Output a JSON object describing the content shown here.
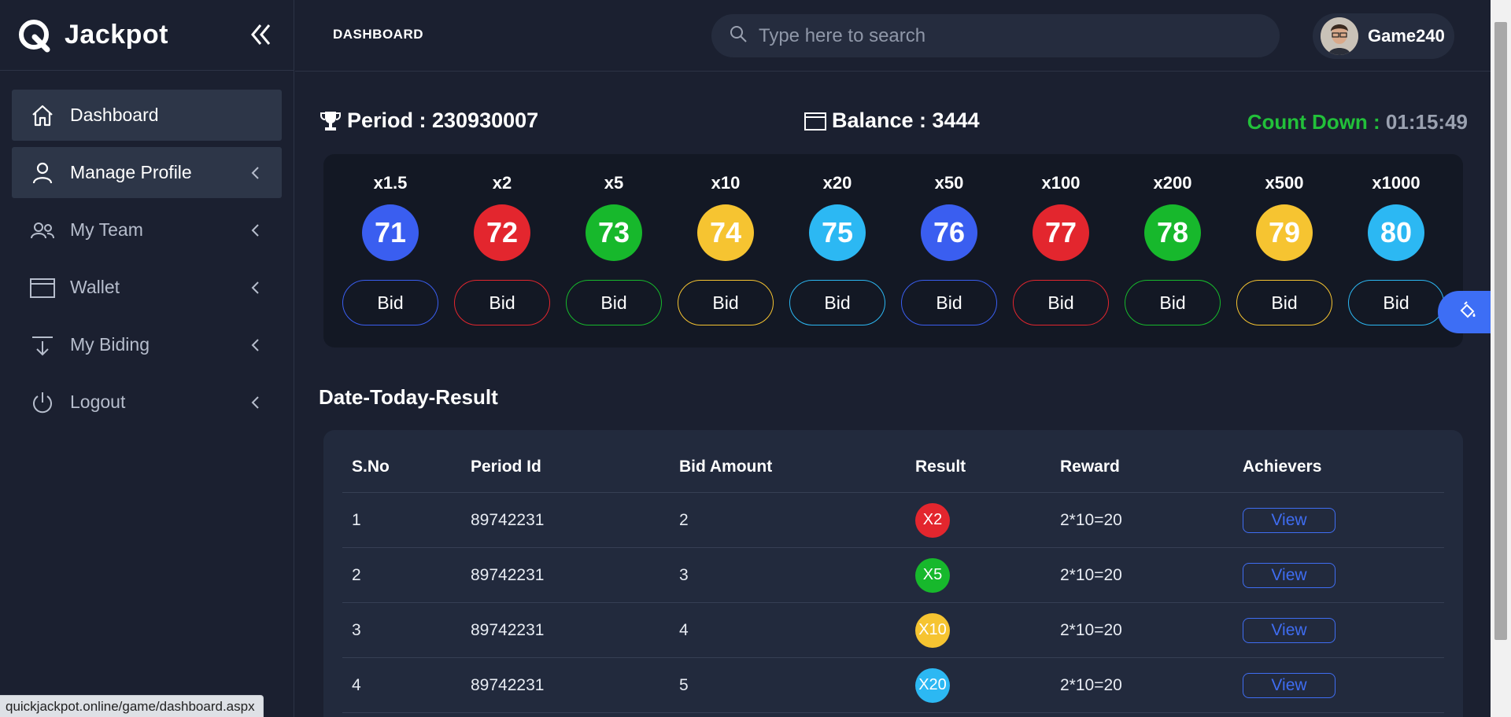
{
  "brand": {
    "name": "Jackpot"
  },
  "sidebar": {
    "items": [
      {
        "label": "Dashboard",
        "icon": "home-icon"
      },
      {
        "label": "Manage Profile",
        "icon": "user-icon"
      },
      {
        "label": "My Team",
        "icon": "team-icon"
      },
      {
        "label": "Wallet",
        "icon": "wallet-icon"
      },
      {
        "label": "My Biding",
        "icon": "download-icon"
      },
      {
        "label": "Logout",
        "icon": "power-icon"
      }
    ]
  },
  "header": {
    "title": "DASHBOARD",
    "search_placeholder": "Type here to search",
    "username": "Game240"
  },
  "stats": {
    "period_label": "Period : 230930007",
    "balance_label": "Balance : 3444",
    "countdown_label": "Count Down :",
    "countdown_time": "01:15:49"
  },
  "bids": [
    {
      "mult": "x1.5",
      "num": "71",
      "color": "#3a5ef0",
      "bid": "Bid"
    },
    {
      "mult": "x2",
      "num": "72",
      "color": "#e3262e",
      "bid": "Bid"
    },
    {
      "mult": "x5",
      "num": "73",
      "color": "#17b82c",
      "bid": "Bid"
    },
    {
      "mult": "x10",
      "num": "74",
      "color": "#f6c431",
      "bid": "Bid"
    },
    {
      "mult": "x20",
      "num": "75",
      "color": "#2cb8f3",
      "bid": "Bid"
    },
    {
      "mult": "x50",
      "num": "76",
      "color": "#3a5ef0",
      "bid": "Bid"
    },
    {
      "mult": "x100",
      "num": "77",
      "color": "#e3262e",
      "bid": "Bid"
    },
    {
      "mult": "x200",
      "num": "78",
      "color": "#17b82c",
      "bid": "Bid"
    },
    {
      "mult": "x500",
      "num": "79",
      "color": "#f6c431",
      "bid": "Bid"
    },
    {
      "mult": "x1000",
      "num": "80",
      "color": "#2cb8f3",
      "bid": "Bid"
    }
  ],
  "results": {
    "title": "Date-Today-Result",
    "columns": [
      "S.No",
      "Period Id",
      "Bid Amount",
      "Result",
      "Reward",
      "Achievers"
    ],
    "rows": [
      {
        "sno": "1",
        "period": "89742231",
        "amount": "2",
        "result": "X2",
        "result_color": "#e3262e",
        "reward": "2*10=20",
        "action": "View"
      },
      {
        "sno": "2",
        "period": "89742231",
        "amount": "3",
        "result": "X5",
        "result_color": "#17b82c",
        "reward": "2*10=20",
        "action": "View"
      },
      {
        "sno": "3",
        "period": "89742231",
        "amount": "4",
        "result": "X10",
        "result_color": "#f6c431",
        "reward": "2*10=20",
        "action": "View"
      },
      {
        "sno": "4",
        "period": "89742231",
        "amount": "5",
        "result": "X20",
        "result_color": "#2cb8f3",
        "reward": "2*10=20",
        "action": "View"
      }
    ]
  },
  "status_bar": {
    "url": "quickjackpot.online/game/dashboard.aspx"
  }
}
